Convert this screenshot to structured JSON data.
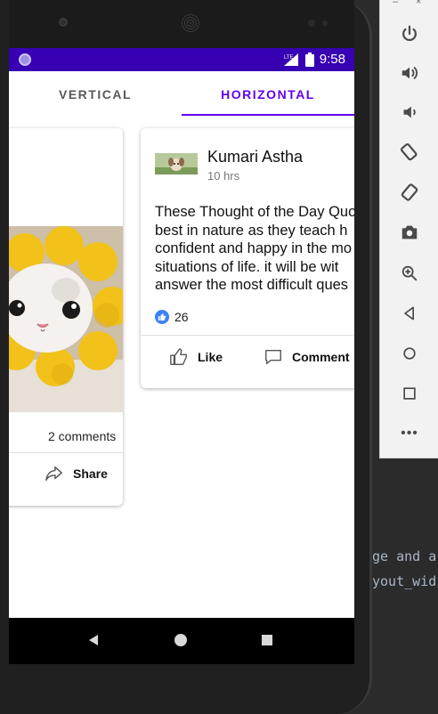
{
  "ide": {
    "code_lines": [
      "ge and a",
      "yout_wid"
    ]
  },
  "emulator_toolbar": {
    "window_controls": [
      "–",
      "×"
    ],
    "buttons": [
      "power-icon",
      "volume-up-icon",
      "volume-down-icon",
      "rotate-left-icon",
      "rotate-right-icon",
      "camera-icon",
      "zoom-icon",
      "back-icon",
      "home-icon",
      "overview-icon",
      "more-icon"
    ],
    "more_label": "•••"
  },
  "status_bar": {
    "network": "LTE",
    "time": "9:58",
    "color": "#3700b3"
  },
  "tabs": [
    {
      "label": "VERTICAL",
      "selected": false
    },
    {
      "label": "HORIZONTAL",
      "selected": true
    }
  ],
  "accent_color": "#6200ee",
  "cards": {
    "left": {
      "comments": "2 comments",
      "share_label": "Share"
    },
    "right": {
      "author": "Kumari Astha",
      "time": "10 hrs",
      "text_lines": [
        "These Thought of the Day Quo",
        "best in nature as they teach h",
        "confident and happy in the mo",
        "situations of life. it will be wit",
        "answer the most difficult ques"
      ],
      "likes": "26",
      "like_label": "Like",
      "comment_label": "Comment"
    }
  }
}
